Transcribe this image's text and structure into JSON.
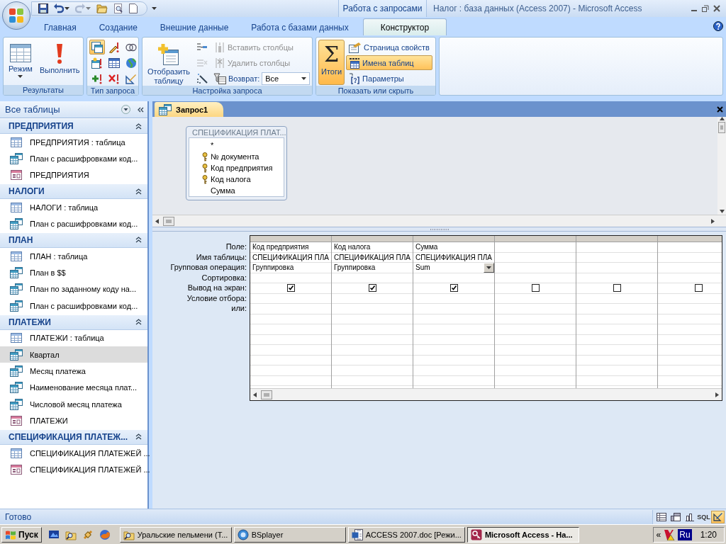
{
  "window": {
    "title": "Налог : база данных (Access 2007) - Microsoft Access"
  },
  "contextual_tab": "Работа с запросами",
  "tabs": [
    {
      "label": "Главная",
      "selected": false
    },
    {
      "label": "Создание",
      "selected": false
    },
    {
      "label": "Внешние данные",
      "selected": false
    },
    {
      "label": "Работа с базами данных",
      "selected": false
    },
    {
      "label": "Конструктор",
      "selected": true
    }
  ],
  "ribbon": {
    "groups": [
      {
        "title": "Результаты",
        "columns": [
          [
            {
              "kind": "large",
              "label": "Режим",
              "dropdown": true
            }
          ],
          [
            {
              "kind": "large",
              "label": "Выполнить"
            }
          ]
        ]
      },
      {
        "title": "Тип запроса",
        "columns": [
          [
            {
              "kind": "icon",
              "selected": true
            },
            {
              "kind": "icon",
              "selected": false
            },
            {
              "kind": "icon",
              "selected": false
            }
          ],
          [
            {
              "kind": "icon",
              "selected": false
            },
            {
              "kind": "icon",
              "selected": false
            },
            {
              "kind": "icon",
              "selected": false
            }
          ],
          [
            {
              "kind": "icon",
              "selected": false
            },
            {
              "kind": "icon",
              "selected": false
            },
            {
              "kind": "icon",
              "selected": false
            }
          ]
        ]
      },
      {
        "title": "Настройка запроса",
        "columns": [
          [
            {
              "kind": "large",
              "label": "Отобразить таблицу"
            }
          ],
          [
            {
              "kind": "icon",
              "disabled": false
            },
            {
              "kind": "icon",
              "disabled": true
            },
            {
              "kind": "icon",
              "disabled": false
            }
          ],
          [
            {
              "kind": "small",
              "label": "Вставить столбцы",
              "disabled": true
            },
            {
              "kind": "small",
              "label": "Удалить столбцы",
              "disabled": true
            },
            {
              "kind": "combo",
              "label": "Возврат:",
              "value": "Все"
            }
          ]
        ]
      },
      {
        "title": "Показать или скрыть",
        "columns": [
          [
            {
              "kind": "large",
              "symbol": "Σ",
              "label": "Итоги",
              "selected": true
            }
          ],
          [
            {
              "kind": "small",
              "label": "Страница свойств",
              "selected": false
            },
            {
              "kind": "small",
              "label": "Имена таблиц",
              "selected": true
            },
            {
              "kind": "small",
              "label": "Параметры",
              "selected": false
            }
          ]
        ]
      }
    ]
  },
  "nav": {
    "title": "Все таблицы",
    "groups": [
      {
        "title": "ПРЕДПРИЯТИЯ",
        "expanded": true,
        "items": [
          {
            "label": "ПРЕДПРИЯТИЯ : таблица",
            "kind": "table",
            "selected": false
          },
          {
            "label": "План с расшифровками код...",
            "kind": "query",
            "selected": false
          },
          {
            "label": "ПРЕДПРИЯТИЯ",
            "kind": "form",
            "selected": false
          }
        ]
      },
      {
        "title": "НАЛОГИ",
        "expanded": true,
        "items": [
          {
            "label": "НАЛОГИ : таблица",
            "kind": "table",
            "selected": false
          },
          {
            "label": "План с расшифровками код...",
            "kind": "query",
            "selected": false
          }
        ]
      },
      {
        "title": "ПЛАН",
        "expanded": true,
        "items": [
          {
            "label": "ПЛАН : таблица",
            "kind": "table",
            "selected": false
          },
          {
            "label": "План в $$",
            "kind": "query",
            "selected": false
          },
          {
            "label": "План по заданному коду на...",
            "kind": "query",
            "selected": false
          },
          {
            "label": "План с расшифровками код...",
            "kind": "query",
            "selected": false
          }
        ]
      },
      {
        "title": "ПЛАТЕЖИ",
        "expanded": true,
        "items": [
          {
            "label": "ПЛАТЕЖИ : таблица",
            "kind": "table",
            "selected": false
          },
          {
            "label": "Квартал",
            "kind": "query",
            "selected": true
          },
          {
            "label": "Месяц платежа",
            "kind": "query",
            "selected": false
          },
          {
            "label": "Наименование месяца плат...",
            "kind": "query",
            "selected": false
          },
          {
            "label": "Числовой месяц платежа",
            "kind": "query",
            "selected": false
          },
          {
            "label": "ПЛАТЕЖИ",
            "kind": "form",
            "selected": false
          }
        ]
      },
      {
        "title": "СПЕЦИФИКАЦИЯ ПЛАТЕЖ...",
        "expanded": true,
        "items": [
          {
            "label": "СПЕЦИФИКАЦИЯ ПЛАТЕЖЕЙ ...",
            "kind": "table",
            "selected": false
          },
          {
            "label": "СПЕЦИФИКАЦИЯ ПЛАТЕЖЕЙ ...",
            "kind": "form",
            "selected": false
          }
        ]
      }
    ]
  },
  "doc_tabs": [
    {
      "label": "Запрос1",
      "selected": true
    }
  ],
  "field_list": {
    "title": "СПЕЦИФИКАЦИЯ ПЛАТ...",
    "fields": [
      {
        "name": "*",
        "key": false
      },
      {
        "name": "№ документа",
        "key": true
      },
      {
        "name": "Код предприятия",
        "key": true
      },
      {
        "name": "Код налога",
        "key": true
      },
      {
        "name": "Сумма",
        "key": false
      }
    ]
  },
  "design_grid": {
    "row_labels": [
      "Поле:",
      "Имя таблицы:",
      "Групповая операция:",
      "Сортировка:",
      "Вывод на экран:",
      "Условие отбора:",
      "или:"
    ],
    "columns": [
      {
        "field": "Код предприятия",
        "table": "СПЕЦИФИКАЦИЯ ПЛА",
        "total": "Группировка",
        "show": true
      },
      {
        "field": "Код налога",
        "table": "СПЕЦИФИКАЦИЯ ПЛА",
        "total": "Группировка",
        "show": true
      },
      {
        "field": "Сумма",
        "table": "СПЕЦИФИКАЦИЯ ПЛА",
        "total": "Sum",
        "show": true,
        "focused": true
      },
      {
        "show": false
      },
      {
        "show": false
      },
      {
        "show": false
      }
    ]
  },
  "status_bar": {
    "text": "Готово",
    "views": [
      {
        "kind": "datasheet",
        "selected": false
      },
      {
        "kind": "pivot_table",
        "selected": false
      },
      {
        "kind": "pivot_chart",
        "selected": false
      },
      {
        "kind": "sql",
        "label": "SQL",
        "selected": false
      },
      {
        "kind": "design",
        "selected": true
      }
    ]
  },
  "taskbar": {
    "start": "Пуск",
    "tasks": [
      {
        "label": "Уральские пельмени (Т...",
        "selected": false
      },
      {
        "label": "BSplayer",
        "selected": false
      },
      {
        "label": "ACCESS 2007.doc [Режи...",
        "selected": false
      },
      {
        "label": "Microsoft Access - На...",
        "selected": true
      }
    ],
    "tray": {
      "expand": "«",
      "language": "Ru",
      "time": "1:20"
    }
  }
}
